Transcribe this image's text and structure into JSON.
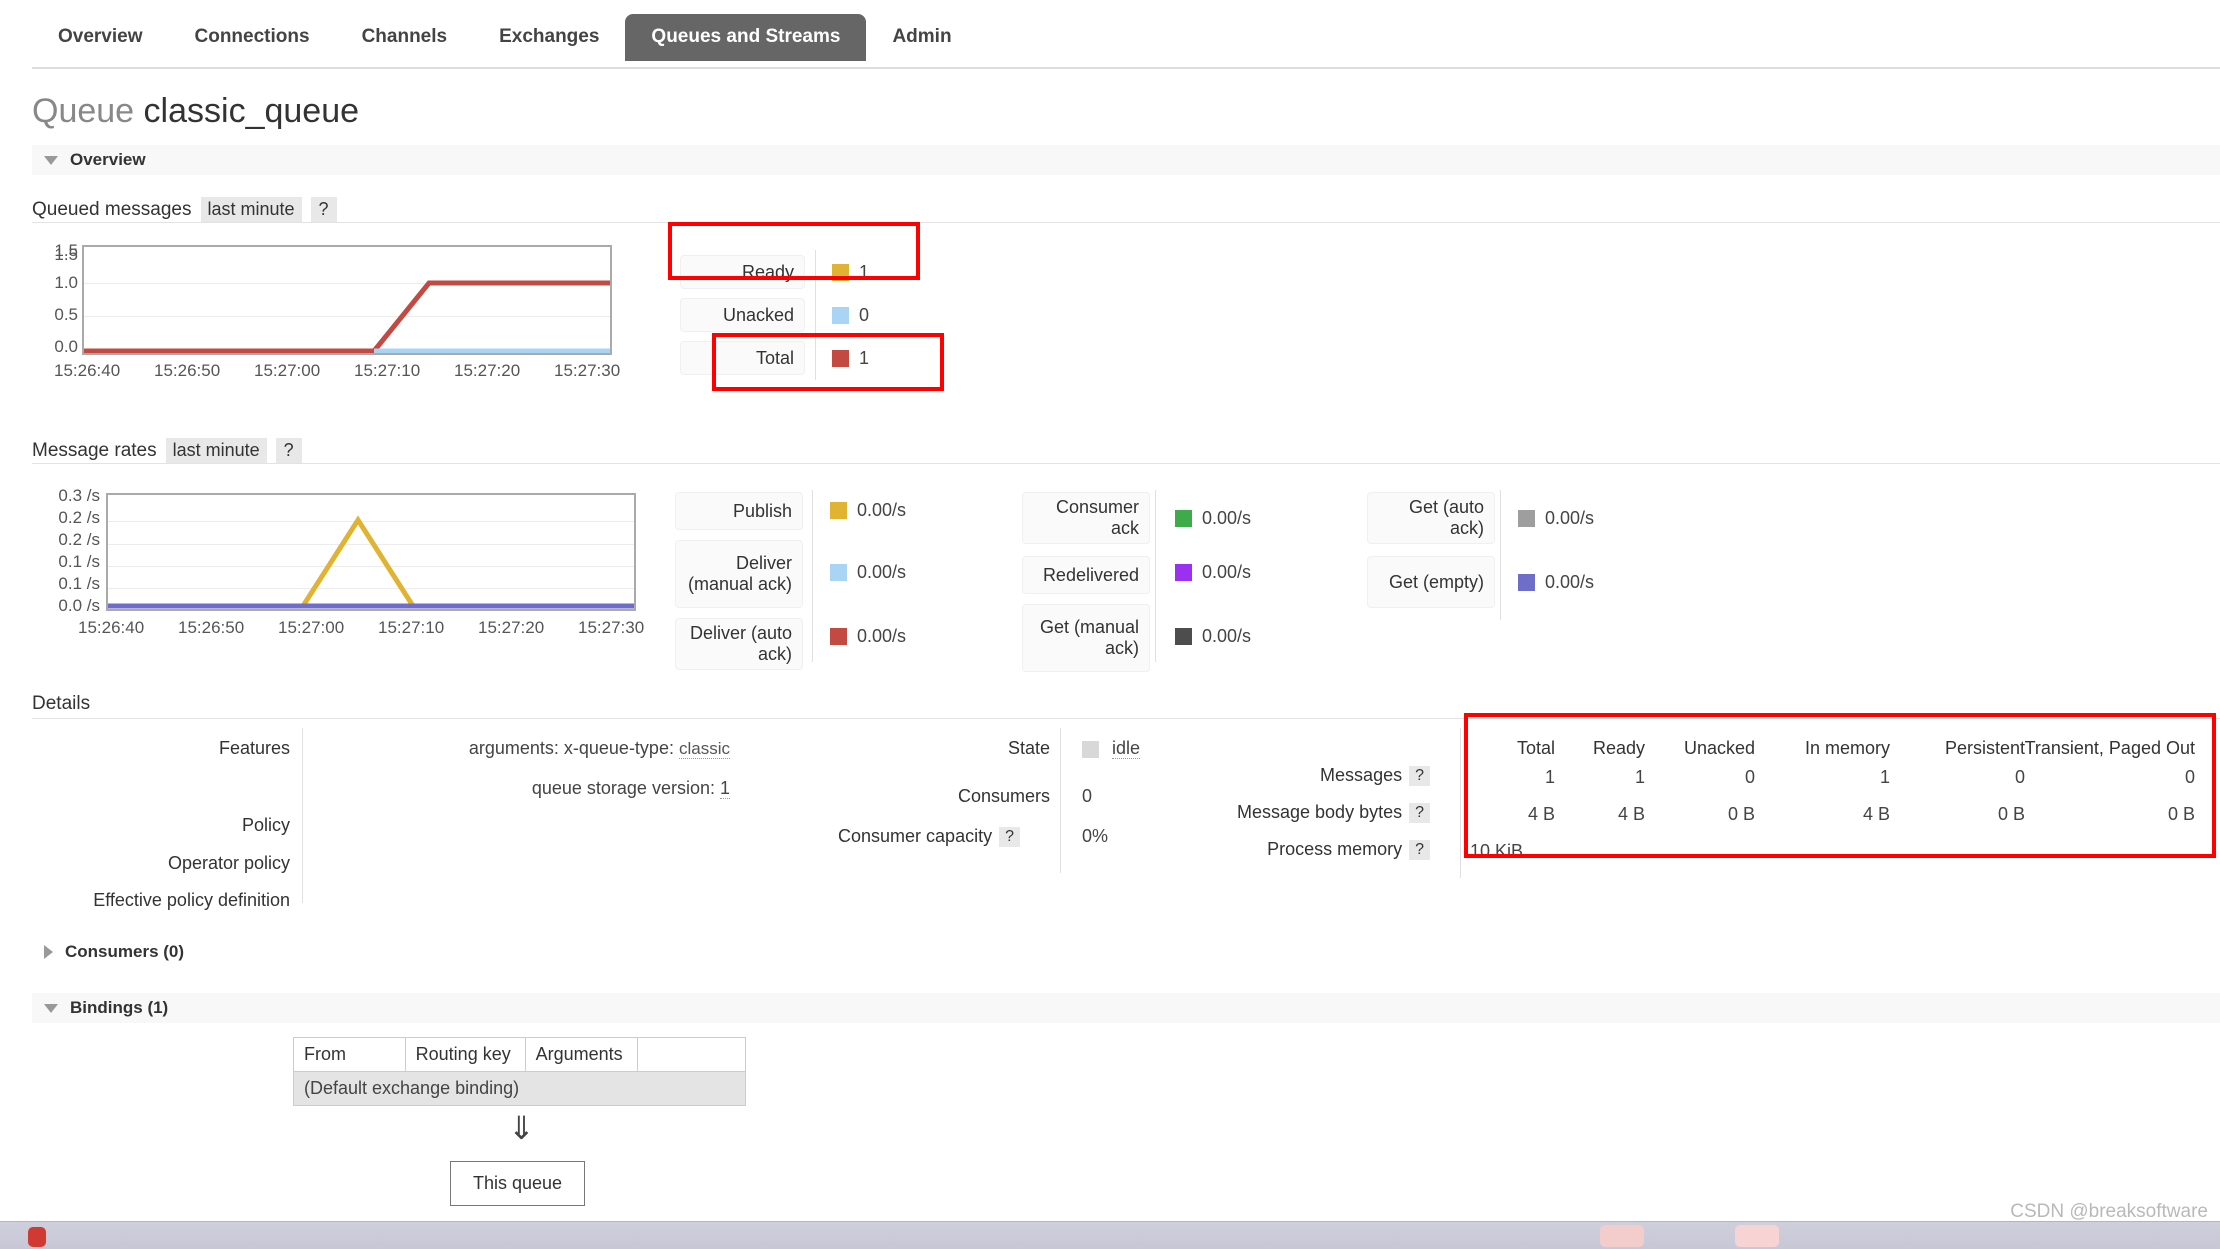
{
  "nav": {
    "items": [
      {
        "label": "Overview",
        "active": false
      },
      {
        "label": "Connections",
        "active": false
      },
      {
        "label": "Channels",
        "active": false
      },
      {
        "label": "Exchanges",
        "active": false
      },
      {
        "label": "Queues and Streams",
        "active": true
      },
      {
        "label": "Admin",
        "active": false
      }
    ]
  },
  "header": {
    "title_prefix": "Queue",
    "title_name": "classic_queue"
  },
  "overview_section": {
    "label": "Overview"
  },
  "queued_messages": {
    "title": "Queued messages",
    "period_chip": "last minute",
    "help_chip": "?",
    "legend": [
      {
        "label": "Ready",
        "value": "1",
        "color": "#e0b432"
      },
      {
        "label": "Unacked",
        "value": "0",
        "color": "#aad4f5"
      },
      {
        "label": "Total",
        "value": "1",
        "color": "#c24a43"
      }
    ]
  },
  "message_rates": {
    "title": "Message rates",
    "period_chip": "last minute",
    "help_chip": "?",
    "col1": [
      {
        "label": "Publish",
        "value": "0.00/s",
        "color": "#e0b432"
      },
      {
        "label": "Deliver (manual ack)",
        "value": "0.00/s",
        "color": "#aad4f5"
      },
      {
        "label": "Deliver (auto ack)",
        "value": "0.00/s",
        "color": "#c24a43"
      }
    ],
    "col2": [
      {
        "label": "Consumer ack",
        "value": "0.00/s",
        "color": "#3faa4a"
      },
      {
        "label": "Redelivered",
        "value": "0.00/s",
        "color": "#9b30f0"
      },
      {
        "label": "Get (manual ack)",
        "value": "0.00/s",
        "color": "#4d4d4d"
      }
    ],
    "col3": [
      {
        "label": "Get (auto ack)",
        "value": "0.00/s",
        "color": "#9e9e9e"
      },
      {
        "label": "Get (empty)",
        "value": "0.00/s",
        "color": "#6e6ec8"
      }
    ]
  },
  "details": {
    "title": "Details",
    "labels": {
      "features": "Features",
      "policy": "Policy",
      "operator_policy": "Operator policy",
      "effective_policy_definition": "Effective policy definition",
      "state": "State",
      "consumers": "Consumers",
      "consumer_capacity": "Consumer capacity",
      "messages": "Messages",
      "message_body_bytes": "Message body bytes",
      "process_memory": "Process memory"
    },
    "features": {
      "arguments_label": "arguments:",
      "arguments_key": "x-queue-type:",
      "arguments_value": "classic",
      "storage_label": "queue storage version:",
      "storage_value": "1"
    },
    "state_value": "idle",
    "consumers_value": "0",
    "consumer_capacity_value": "0%",
    "help_chip": "?"
  },
  "stats_table": {
    "headers": [
      "Total",
      "Ready",
      "Unacked",
      "In memory",
      "Persistent",
      "Transient, Paged Out"
    ],
    "rows": [
      {
        "name": "messages",
        "values": [
          "1",
          "1",
          "0",
          "1",
          "0",
          "0"
        ]
      },
      {
        "name": "message_body_bytes",
        "values": [
          "4 B",
          "4 B",
          "0 B",
          "4 B",
          "0 B",
          "0 B"
        ]
      }
    ],
    "process_memory": "10 KiB"
  },
  "consumers_section": {
    "label": "Consumers (0)"
  },
  "bindings_section": {
    "label": "Bindings (1)",
    "table_headers": [
      "From",
      "Routing key",
      "Arguments",
      ""
    ],
    "row_text": "(Default exchange binding)",
    "arrow": "⇓",
    "this_queue": "This queue"
  },
  "watermark": "CSDN @breaksoftware",
  "chart_data": [
    {
      "type": "line",
      "title": "Queued messages",
      "xlabel": "",
      "ylabel": "",
      "ylim": [
        0.0,
        1.5
      ],
      "yticks": [
        "0.0",
        "0.5",
        "1.0",
        "1.5"
      ],
      "xticks": [
        "15:26:40",
        "15:26:50",
        "15:27:00",
        "15:27:10",
        "15:27:20",
        "15:27:30"
      ],
      "grid": true,
      "legend_position": "right",
      "series": [
        {
          "name": "Ready",
          "color": "#e0b432",
          "values": [
            0,
            0,
            0,
            1,
            1,
            1
          ]
        },
        {
          "name": "Unacked",
          "color": "#aad4f5",
          "values": [
            0,
            0,
            0,
            0,
            0,
            0
          ]
        },
        {
          "name": "Total",
          "color": "#c24a43",
          "values": [
            0,
            0,
            0,
            1,
            1,
            1
          ]
        }
      ]
    },
    {
      "type": "line",
      "title": "Message rates",
      "xlabel": "",
      "ylabel": "",
      "ylim": [
        0.0,
        0.3
      ],
      "yticks": [
        "0.0 /s",
        "0.1 /s",
        "0.1 /s",
        "0.2 /s",
        "0.2 /s",
        "0.3 /s"
      ],
      "xticks": [
        "15:26:40",
        "15:26:50",
        "15:27:00",
        "15:27:10",
        "15:27:20",
        "15:27:30"
      ],
      "grid": true,
      "legend_position": "right",
      "series": [
        {
          "name": "Publish",
          "color": "#e0b432",
          "values": [
            0,
            0,
            0.2,
            0,
            0,
            0
          ]
        },
        {
          "name": "Get (empty)",
          "color": "#6e6ec8",
          "values": [
            0,
            0,
            0,
            0,
            0,
            0
          ]
        }
      ]
    }
  ]
}
